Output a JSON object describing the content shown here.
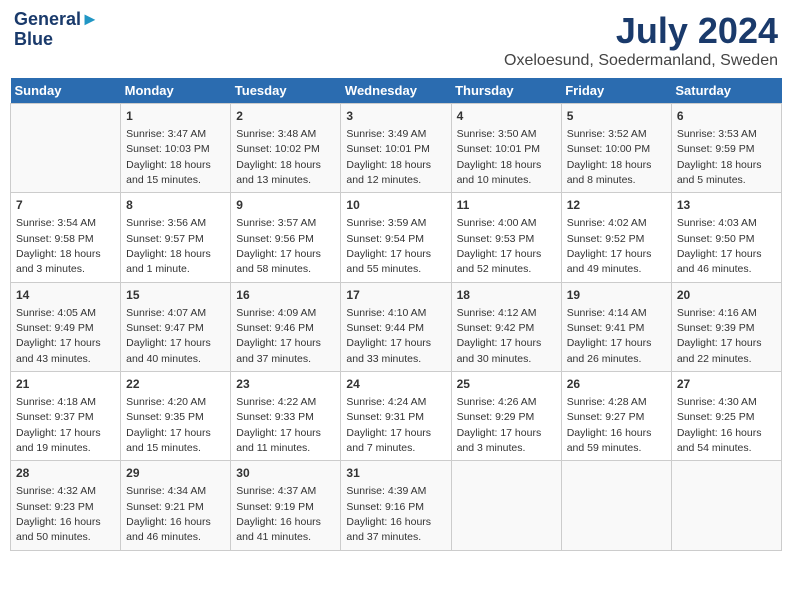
{
  "logo": {
    "line1": "General",
    "line2": "Blue"
  },
  "title": "July 2024",
  "subtitle": "Oxeloesund, Soedermanland, Sweden",
  "days_of_week": [
    "Sunday",
    "Monday",
    "Tuesday",
    "Wednesday",
    "Thursday",
    "Friday",
    "Saturday"
  ],
  "weeks": [
    [
      {
        "day": "",
        "info": ""
      },
      {
        "day": "1",
        "info": "Sunrise: 3:47 AM\nSunset: 10:03 PM\nDaylight: 18 hours\nand 15 minutes."
      },
      {
        "day": "2",
        "info": "Sunrise: 3:48 AM\nSunset: 10:02 PM\nDaylight: 18 hours\nand 13 minutes."
      },
      {
        "day": "3",
        "info": "Sunrise: 3:49 AM\nSunset: 10:01 PM\nDaylight: 18 hours\nand 12 minutes."
      },
      {
        "day": "4",
        "info": "Sunrise: 3:50 AM\nSunset: 10:01 PM\nDaylight: 18 hours\nand 10 minutes."
      },
      {
        "day": "5",
        "info": "Sunrise: 3:52 AM\nSunset: 10:00 PM\nDaylight: 18 hours\nand 8 minutes."
      },
      {
        "day": "6",
        "info": "Sunrise: 3:53 AM\nSunset: 9:59 PM\nDaylight: 18 hours\nand 5 minutes."
      }
    ],
    [
      {
        "day": "7",
        "info": "Sunrise: 3:54 AM\nSunset: 9:58 PM\nDaylight: 18 hours\nand 3 minutes."
      },
      {
        "day": "8",
        "info": "Sunrise: 3:56 AM\nSunset: 9:57 PM\nDaylight: 18 hours\nand 1 minute."
      },
      {
        "day": "9",
        "info": "Sunrise: 3:57 AM\nSunset: 9:56 PM\nDaylight: 17 hours\nand 58 minutes."
      },
      {
        "day": "10",
        "info": "Sunrise: 3:59 AM\nSunset: 9:54 PM\nDaylight: 17 hours\nand 55 minutes."
      },
      {
        "day": "11",
        "info": "Sunrise: 4:00 AM\nSunset: 9:53 PM\nDaylight: 17 hours\nand 52 minutes."
      },
      {
        "day": "12",
        "info": "Sunrise: 4:02 AM\nSunset: 9:52 PM\nDaylight: 17 hours\nand 49 minutes."
      },
      {
        "day": "13",
        "info": "Sunrise: 4:03 AM\nSunset: 9:50 PM\nDaylight: 17 hours\nand 46 minutes."
      }
    ],
    [
      {
        "day": "14",
        "info": "Sunrise: 4:05 AM\nSunset: 9:49 PM\nDaylight: 17 hours\nand 43 minutes."
      },
      {
        "day": "15",
        "info": "Sunrise: 4:07 AM\nSunset: 9:47 PM\nDaylight: 17 hours\nand 40 minutes."
      },
      {
        "day": "16",
        "info": "Sunrise: 4:09 AM\nSunset: 9:46 PM\nDaylight: 17 hours\nand 37 minutes."
      },
      {
        "day": "17",
        "info": "Sunrise: 4:10 AM\nSunset: 9:44 PM\nDaylight: 17 hours\nand 33 minutes."
      },
      {
        "day": "18",
        "info": "Sunrise: 4:12 AM\nSunset: 9:42 PM\nDaylight: 17 hours\nand 30 minutes."
      },
      {
        "day": "19",
        "info": "Sunrise: 4:14 AM\nSunset: 9:41 PM\nDaylight: 17 hours\nand 26 minutes."
      },
      {
        "day": "20",
        "info": "Sunrise: 4:16 AM\nSunset: 9:39 PM\nDaylight: 17 hours\nand 22 minutes."
      }
    ],
    [
      {
        "day": "21",
        "info": "Sunrise: 4:18 AM\nSunset: 9:37 PM\nDaylight: 17 hours\nand 19 minutes."
      },
      {
        "day": "22",
        "info": "Sunrise: 4:20 AM\nSunset: 9:35 PM\nDaylight: 17 hours\nand 15 minutes."
      },
      {
        "day": "23",
        "info": "Sunrise: 4:22 AM\nSunset: 9:33 PM\nDaylight: 17 hours\nand 11 minutes."
      },
      {
        "day": "24",
        "info": "Sunrise: 4:24 AM\nSunset: 9:31 PM\nDaylight: 17 hours\nand 7 minutes."
      },
      {
        "day": "25",
        "info": "Sunrise: 4:26 AM\nSunset: 9:29 PM\nDaylight: 17 hours\nand 3 minutes."
      },
      {
        "day": "26",
        "info": "Sunrise: 4:28 AM\nSunset: 9:27 PM\nDaylight: 16 hours\nand 59 minutes."
      },
      {
        "day": "27",
        "info": "Sunrise: 4:30 AM\nSunset: 9:25 PM\nDaylight: 16 hours\nand 54 minutes."
      }
    ],
    [
      {
        "day": "28",
        "info": "Sunrise: 4:32 AM\nSunset: 9:23 PM\nDaylight: 16 hours\nand 50 minutes."
      },
      {
        "day": "29",
        "info": "Sunrise: 4:34 AM\nSunset: 9:21 PM\nDaylight: 16 hours\nand 46 minutes."
      },
      {
        "day": "30",
        "info": "Sunrise: 4:37 AM\nSunset: 9:19 PM\nDaylight: 16 hours\nand 41 minutes."
      },
      {
        "day": "31",
        "info": "Sunrise: 4:39 AM\nSunset: 9:16 PM\nDaylight: 16 hours\nand 37 minutes."
      },
      {
        "day": "",
        "info": ""
      },
      {
        "day": "",
        "info": ""
      },
      {
        "day": "",
        "info": ""
      }
    ]
  ]
}
